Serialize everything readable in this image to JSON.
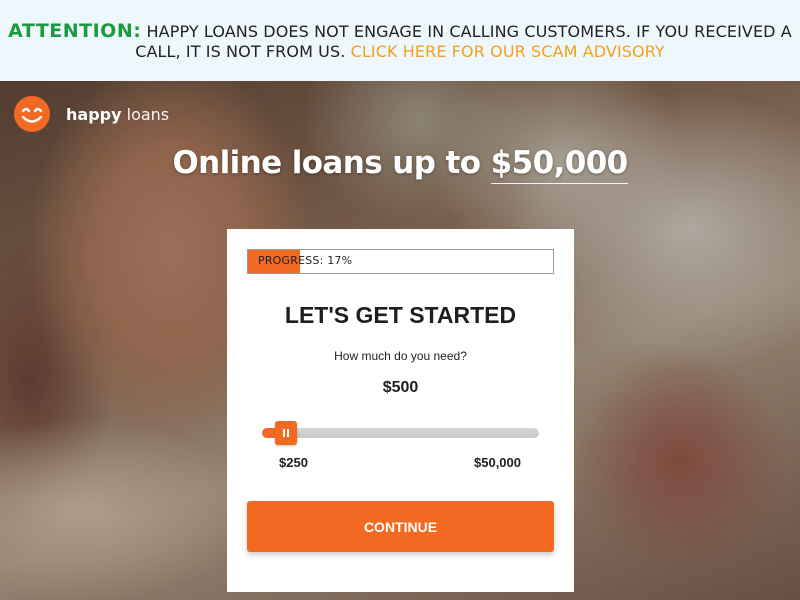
{
  "banner": {
    "attention_label": "ATTENTION:",
    "message": "HAPPY LOANS DOES NOT ENGAGE IN CALLING CUSTOMERS. IF YOU RECEIVED A CALL, IT IS NOT FROM US.",
    "link_text": "CLICK HERE FOR OUR SCAM ADVISORY"
  },
  "brand": {
    "name_bold": "happy",
    "name_light": "loans",
    "logo_icon": "smiley-face-icon",
    "accent_color": "#f26a21"
  },
  "hero": {
    "headline_prefix": "Online loans up to",
    "headline_amount": "$50,000"
  },
  "form": {
    "progress_label": "PROGRESS: 17%",
    "progress_value": 0.17,
    "title": "LET'S GET STARTED",
    "question": "How much do you need?",
    "amount": "$500",
    "slider": {
      "min_label": "$250",
      "max_label": "$50,000",
      "min": 250,
      "max": 50000,
      "value": 500
    },
    "continue_label": "CONTINUE"
  },
  "colors": {
    "attention": "#1a9c3e",
    "scam_link": "#f4a11c",
    "banner_bg": "#eef7fb"
  }
}
